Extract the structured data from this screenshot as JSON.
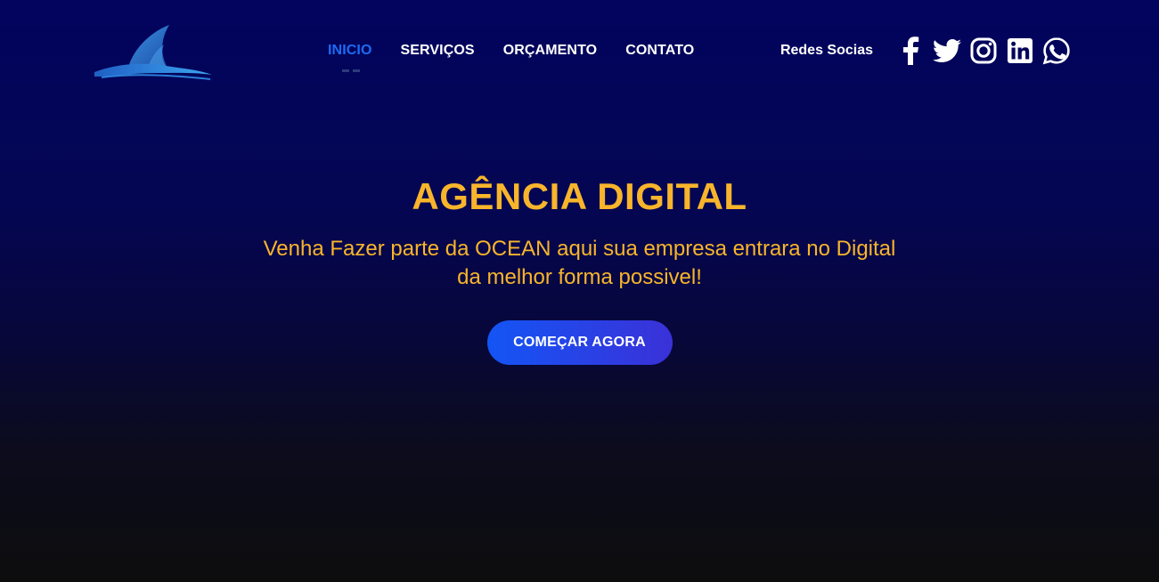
{
  "brand": {
    "logo_icon": "shark-fin-wave-logo",
    "colors": {
      "accent_yellow": "#f8b52b",
      "active_blue": "#1d6bf3",
      "button_gradient_start": "#1455f5",
      "button_gradient_end": "#3a31d8",
      "background_top": "#02045e",
      "background_bottom": "#0d0d0e"
    }
  },
  "nav": {
    "items": [
      {
        "label": "INICIO",
        "active": true
      },
      {
        "label": "SERVIÇOS",
        "active": false
      },
      {
        "label": "ORÇAMENTO",
        "active": false
      },
      {
        "label": "CONTATO",
        "active": false
      }
    ]
  },
  "socials": {
    "label": "Redes Socias",
    "icons": [
      "facebook-icon",
      "twitter-icon",
      "instagram-icon",
      "linkedin-icon",
      "whatsapp-icon"
    ]
  },
  "hero": {
    "title": "AGÊNCIA DIGITAL",
    "subtitle": "Venha Fazer parte da OCEAN aqui sua empresa entrara no Digital da melhor forma possivel!",
    "cta_label": "COMEÇAR AGORA"
  }
}
